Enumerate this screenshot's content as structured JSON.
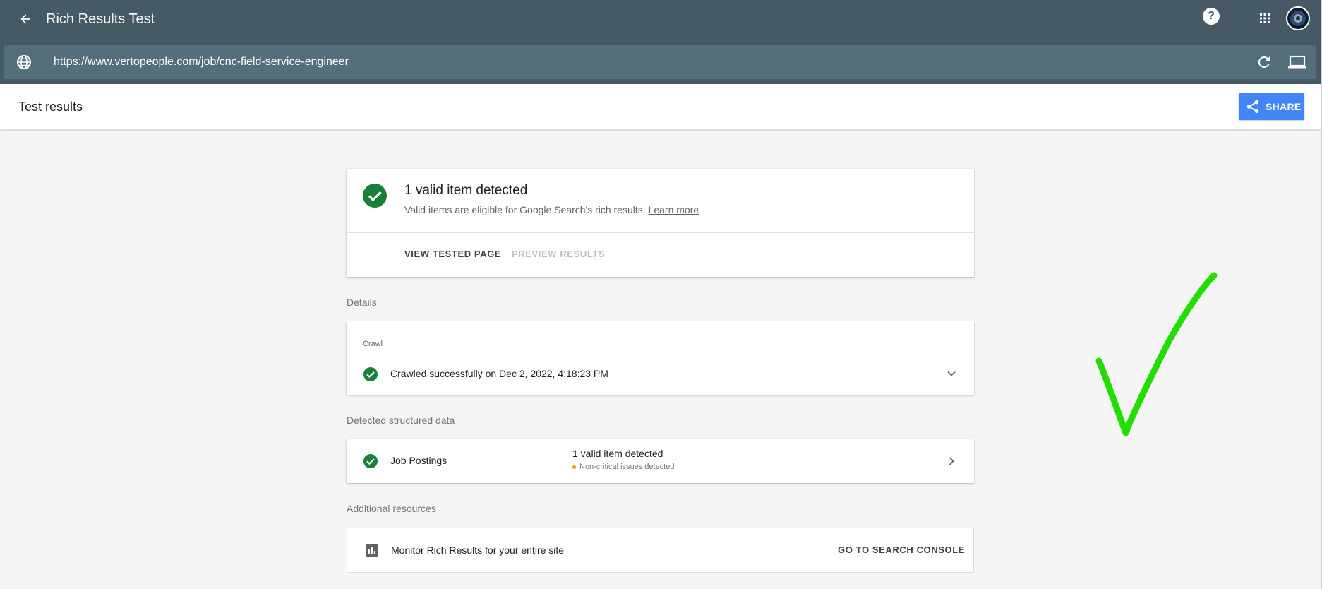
{
  "app": {
    "title": "Rich Results Test",
    "help_glyph": "?",
    "url": "https://www.vertopeople.com/job/cnc-field-service-engineer"
  },
  "subheader": {
    "title": "Test results",
    "share_label": "SHARE"
  },
  "summary": {
    "title": "1 valid item detected",
    "description": "Valid items are eligible for Google Search's rich results.",
    "learn_more": "Learn more",
    "tab_view": "VIEW TESTED PAGE",
    "tab_preview": "PREVIEW RESULTS"
  },
  "details": {
    "section_label": "Details",
    "crawl_label": "Crawl",
    "crawl_status": "Crawled successfully on Dec 2, 2022, 4:18:23 PM"
  },
  "structured": {
    "section_label": "Detected structured data",
    "type_label": "Job Postings",
    "valid_text": "1 valid item detected",
    "issue_text": "Non-critical issues detected"
  },
  "resources": {
    "section_label": "Additional resources",
    "monitor_text": "Monitor Rich Results for your entire site",
    "console_link": "GO TO SEARCH CONSOLE"
  },
  "colors": {
    "appbar": "#455a64",
    "urlbar": "#546e7a",
    "success_green": "#188038",
    "share_blue": "#4285f4",
    "annotation_green": "#22dd00",
    "warning_orange": "#f29900"
  },
  "icons": [
    "back-arrow-icon",
    "help-icon",
    "apps-grid-icon",
    "globe-icon",
    "reload-icon",
    "laptop-icon",
    "share-icon",
    "check-circle-icon",
    "chevron-down-icon",
    "chevron-right-icon",
    "bar-chart-icon"
  ]
}
